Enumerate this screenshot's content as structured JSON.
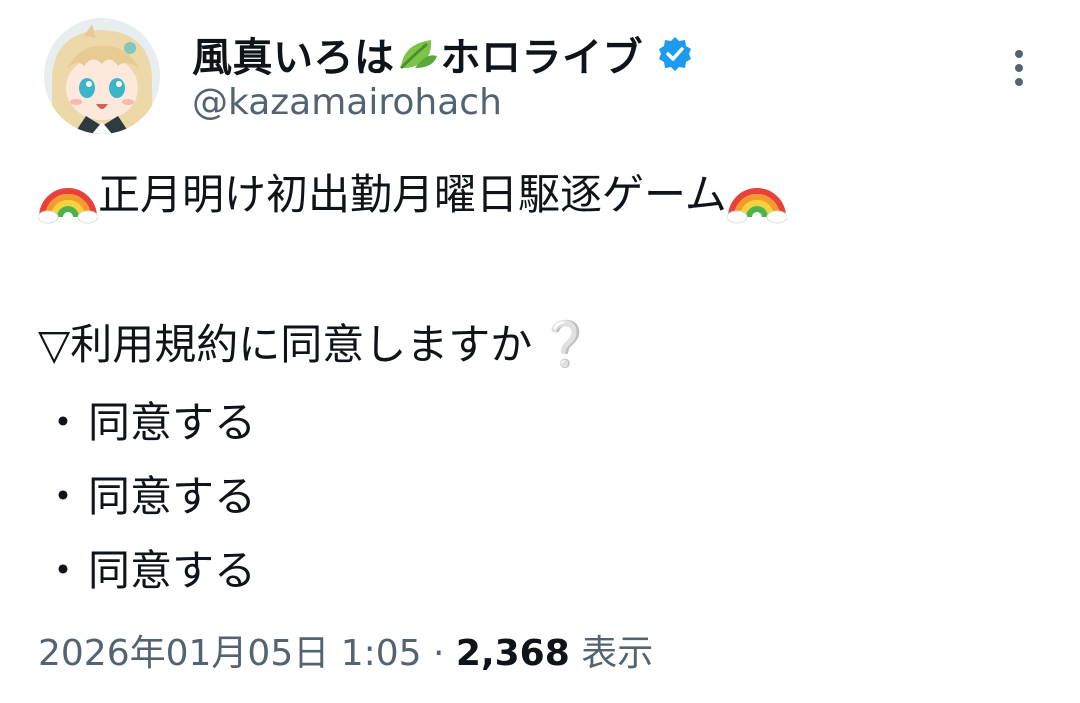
{
  "author": {
    "display_name_part1": "風真いろは",
    "display_name_icon": "leaf-icon",
    "display_name_part2": "ホロライブ",
    "verified_icon": "verified-badge-icon",
    "handle": "@kazamairohach"
  },
  "menu": {
    "icon": "more-options-icon"
  },
  "tweet": {
    "title_emoji": "rainbow-icon",
    "title": "正月明け初出勤月曜日駆逐ゲーム",
    "question": "▽利用規約に同意しますか",
    "question_mark": "❔",
    "bullet_symbol": "・",
    "options": [
      "同意する",
      "同意する",
      "同意する"
    ]
  },
  "meta": {
    "date": "2026年01月05日",
    "time": "1:05",
    "separator": "·",
    "views": "2,368",
    "views_label": "表示"
  },
  "colors": {
    "text": "#0f1419",
    "secondary": "#536471",
    "verified": "#1d9bf0",
    "leaf": "#6db33f"
  }
}
